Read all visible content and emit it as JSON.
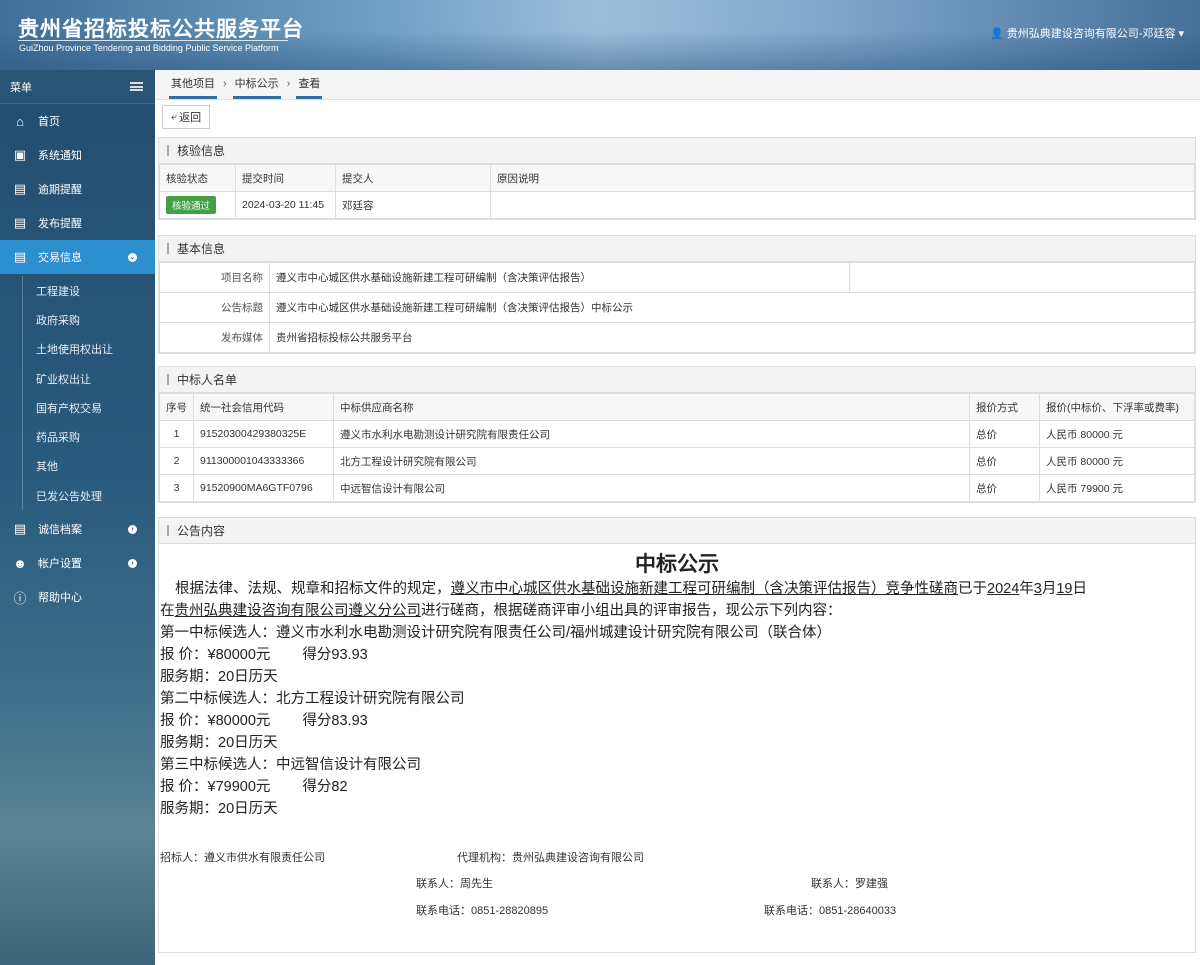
{
  "header": {
    "title": "贵州省招标投标公共服务平台",
    "subtitle": "GuiZhou Province Tendering and Bidding Public Service Platform",
    "user": "贵州弘典建设咨询有限公司-邓廷容"
  },
  "sidebar": {
    "menu_label": "菜单",
    "items": [
      {
        "label": "首页",
        "icon": "home-icon"
      },
      {
        "label": "系统通知",
        "icon": "monitor-icon"
      },
      {
        "label": "逾期提醒",
        "icon": "list-icon"
      },
      {
        "label": "发布提醒",
        "icon": "list-icon"
      },
      {
        "label": "交易信息",
        "icon": "list-icon"
      }
    ],
    "sub_items": [
      "工程建设",
      "政府采购",
      "土地使用权出让",
      "矿业权出让",
      "国有产权交易",
      "药品采购",
      "其他",
      "已发公告处理"
    ],
    "bottom_items": [
      {
        "label": "诚信档案",
        "icon": "doc-icon"
      },
      {
        "label": "帐户设置",
        "icon": "user-icon"
      },
      {
        "label": "帮助中心",
        "icon": "help-icon"
      }
    ]
  },
  "breadcrumb": [
    "其他项目",
    "中标公示",
    "查看"
  ],
  "back_label": "返回",
  "verify": {
    "title": "核验信息",
    "headers": [
      "核验状态",
      "提交时间",
      "提交人",
      "原因说明"
    ],
    "status": "核验通过",
    "time": "2024-03-20 11:45",
    "submitter": "邓廷容",
    "reason": ""
  },
  "basic": {
    "title": "基本信息",
    "project_label": "项目名称",
    "project_value": "遵义市中心城区供水基础设施新建工程可研编制（含决策评估报告）",
    "notice_label": "公告标题",
    "notice_value": "遵义市中心城区供水基础设施新建工程可研编制（含决策评估报告）中标公示",
    "media_label": "发布媒体",
    "media_value": "贵州省招标投标公共服务平台"
  },
  "winners": {
    "title": "中标人名单",
    "headers": [
      "序号",
      "统一社会信用代码",
      "中标供应商名称",
      "报价方式",
      "报价(中标价、下浮率或费率)"
    ],
    "rows": [
      {
        "no": "1",
        "code": "91520300429380325E",
        "name": "遵义市水利水电勘测设计研究院有限责任公司",
        "mode": "总价",
        "price": "人民币 80000 元"
      },
      {
        "no": "2",
        "code": "911300001043333366",
        "name": "北方工程设计研究院有限公司",
        "mode": "总价",
        "price": "人民币 80000 元"
      },
      {
        "no": "3",
        "code": "91520900MA6GTF0796",
        "name": "中远智信设计有限公司",
        "mode": "总价",
        "price": "人民币 79900 元"
      }
    ]
  },
  "notice": {
    "section_title": "公告内容",
    "heading": "中标公示",
    "p1_a": "根据法律、法规、规章和招标文件的规定，",
    "p1_project": "遵义市中心城区供水基础设施新建工程可研编制（含决策评估报告）竞争性磋商",
    "p1_b": "已于",
    "p1_year": "2024",
    "p1_c": "年",
    "p1_month": "3",
    "p1_d": "月",
    "p1_day": "19",
    "p1_e": "日",
    "p2_a": "在",
    "p2_place": "贵州弘典建设咨询有限公司遵义分公司",
    "p2_b": "进行磋商，根据磋商评审小组出具的评审报告，现公示下列内容：",
    "c1": "第一中标候选人：遵义市水利水电勘测设计研究院有限责任公司/福州城建设计研究院有限公司（联合体）",
    "c1_price": "报 价：¥80000元",
    "c1_score": "得分93.93",
    "c1_period": "服务期：20日历天",
    "c2": "第二中标候选人：北方工程设计研究院有限公司",
    "c2_price": "报 价：¥80000元",
    "c2_score": "得分83.93",
    "c2_period": "服务期：20日历天",
    "c3": "第三中标候选人：中远智信设计有限公司",
    "c3_price": "报 价：¥79900元",
    "c3_score": "得分82",
    "c3_period": "服务期：20日历天",
    "tenderer": "招标人：遵义市供水有限责任公司",
    "agency": "代理机构：贵州弘典建设咨询有限公司",
    "contact1": "联系人：周先生",
    "contact2": "联系人：罗建强",
    "phone1": "联系电话：0851-28820895",
    "phone2": "联系电话：0851-28640033"
  }
}
